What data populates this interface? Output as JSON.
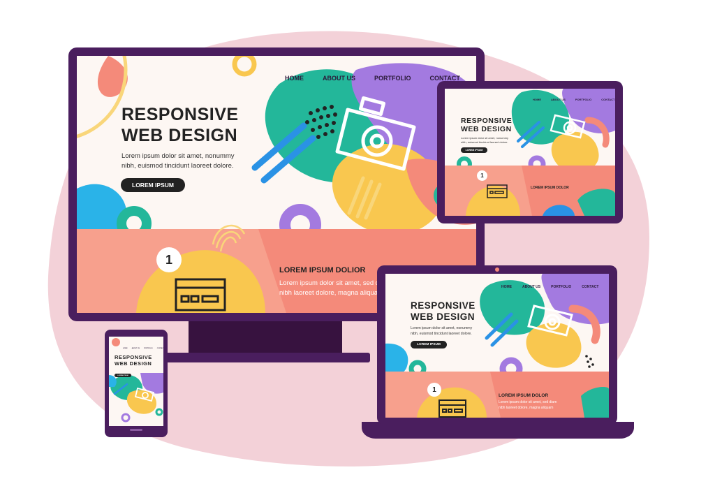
{
  "colors": {
    "frame": "#4a1e5e",
    "frame_dark": "#37123f",
    "backdrop": "#f3d1d8",
    "teal": "#23b79a",
    "yellow": "#f9c74f",
    "purple": "#a37ae0",
    "blue": "#2a92e5",
    "coral": "#f48a7a",
    "salmon": "#f7a08d",
    "dark": "#222222"
  },
  "nav": {
    "home": "HOME",
    "about": "ABOUT US",
    "portfolio": "PORTFOLIO",
    "contact": "CONTACT"
  },
  "hero": {
    "title_line1": "RESPONSIVE",
    "title_line2": "WEB DESIGN",
    "body_line1": "Lorem ipsum dolor sit amet, nonummy",
    "body_line2": "nibh, euismod tincidunt laoreet dolore.",
    "cta": "LOREM IPSUM"
  },
  "feature": {
    "step": "1",
    "title": "LOREM IPSUM DOLIOR",
    "title_short": "LOREM IPSUM DOLOR",
    "text_line1": "Lorem ipsum dolor sit amet, sed diam",
    "text_line2": "nibh laoreet dolore, magna aliquam"
  },
  "icons": {
    "camera": "camera-icon",
    "card": "credit-card-icon"
  }
}
